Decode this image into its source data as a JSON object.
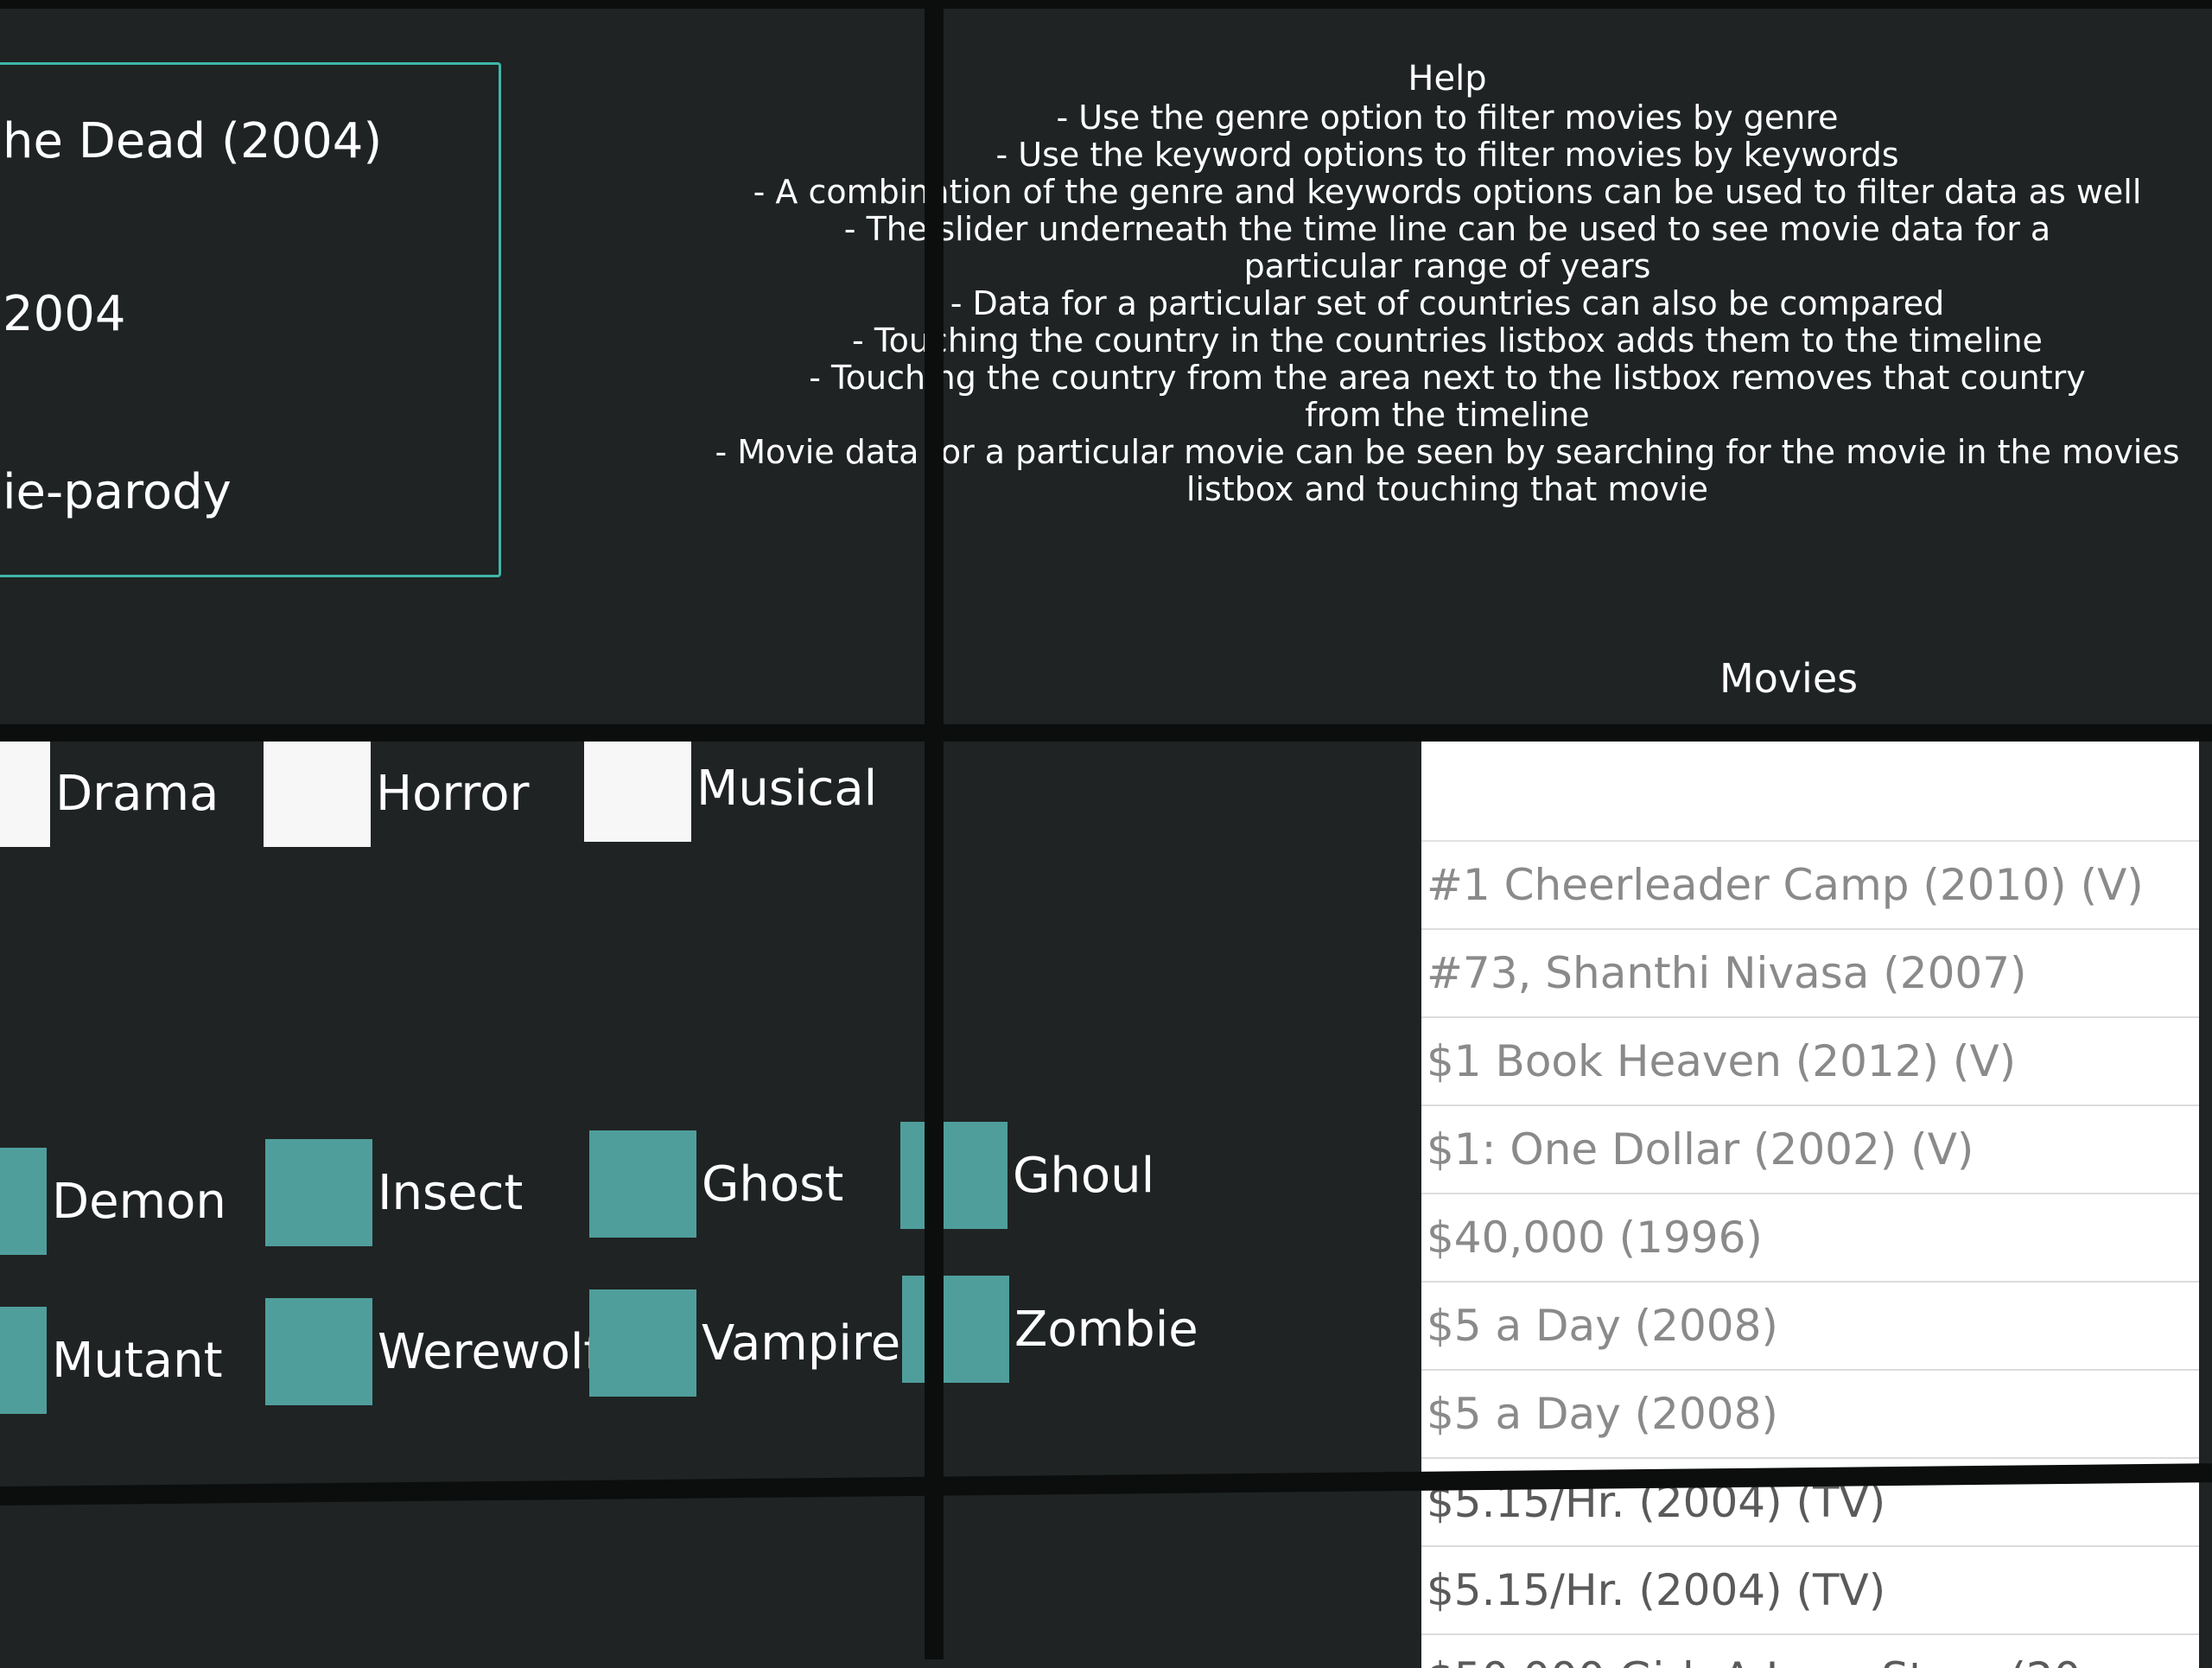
{
  "selected_movie": {
    "title": "he Dead (2004)",
    "year": "2004",
    "keyword": "ie-parody"
  },
  "help": {
    "title": "Help",
    "lines": [
      "- Use the genre option to filter movies by genre",
      "- Use the keyword options to filter movies by keywords",
      "- A combination of the genre and keywords options can be used to filter data as well",
      "- The slider underneath the time line can be used to see movie data for a particular range of years",
      "- Data for a particular set of countries can also be compared",
      "- Touching the country in the countries listbox adds them to the timeline",
      "- Touching the country from the area next to the listbox removes that country from the timeline",
      "- Movie data  for a particular movie can be seen by searching for the movie in the movies listbox and touching that movie"
    ]
  },
  "genres": [
    "Drama",
    "Horror",
    "Musical"
  ],
  "keywords": [
    "Demon",
    "Insect",
    "Ghost",
    "Ghoul",
    "Mutant",
    "Werewolf",
    "Vampire",
    "Zombie"
  ],
  "movies": {
    "heading": "Movies",
    "search_placeholder": "",
    "items": [
      "#1 Cheerleader Camp (2010) (V)",
      "#73, Shanthi Nivasa (2007)",
      "$1 Book Heaven (2012) (V)",
      "$1: One Dollar (2002) (V)",
      "$40,000 (1996)",
      "$5 a Day (2008)",
      "$5 a Day (2008)",
      "$5.15/Hr. (2004) (TV)",
      "$5.15/Hr. (2004) (TV)",
      "$50,000 Girl: A Love Story (20"
    ]
  },
  "colors": {
    "background": "#1f2323",
    "accent": "#3fb6a8",
    "keyword_checkbox": "#4f9e9c",
    "genre_checkbox": "#f7f7f7"
  }
}
